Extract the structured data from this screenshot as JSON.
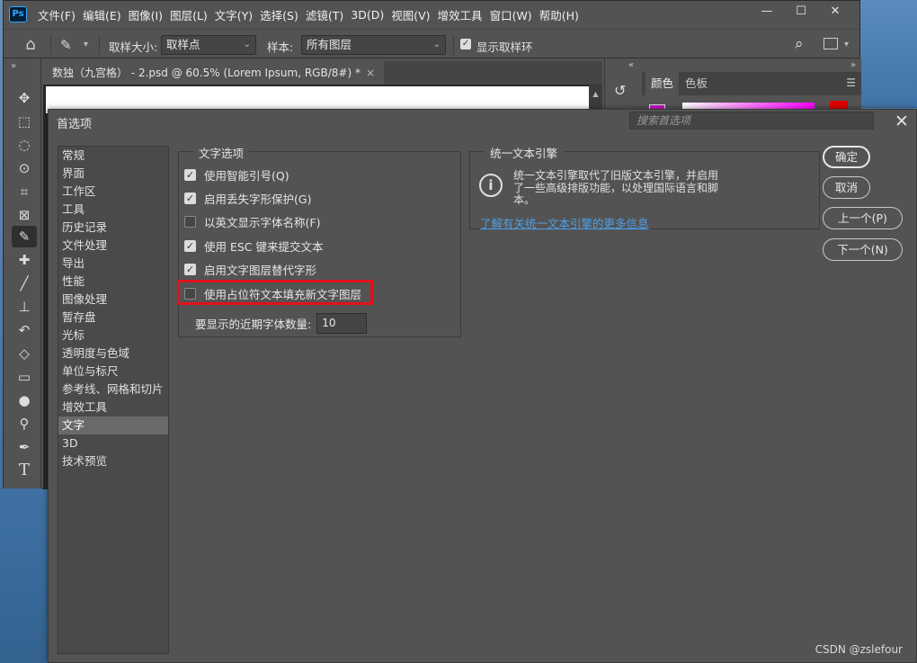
{
  "app": {
    "logo_text": "Ps",
    "menu": [
      "文件(F)",
      "编辑(E)",
      "图像(I)",
      "图层(L)",
      "文字(Y)",
      "选择(S)",
      "滤镜(T)",
      "3D(D)",
      "视图(V)",
      "增效工具",
      "窗口(W)",
      "帮助(H)"
    ],
    "window_controls": [
      "—",
      "☐",
      "✕"
    ]
  },
  "options_bar": {
    "sample_size_label": "取样大小:",
    "sample_size_value": "取样点",
    "sample_label": "样本:",
    "sample_value": "所有图层",
    "show_ring_label": "显示取样环",
    "show_ring_checked": true
  },
  "document": {
    "tab_title": "数独（九宫格） - 2.psd @ 60.5% (Lorem Ipsum, RGB/8#) *",
    "tab_close": "×"
  },
  "panels": {
    "tabs": [
      "颜色",
      "色板"
    ],
    "active_tab": "颜色"
  },
  "dialog": {
    "title": "首选项",
    "search_placeholder": "搜索首选项",
    "close": "✕",
    "categories": [
      "常规",
      "界面",
      "工作区",
      "工具",
      "历史记录",
      "文件处理",
      "导出",
      "性能",
      "图像处理",
      "暂存盘",
      "光标",
      "透明度与色域",
      "单位与标尺",
      "参考线、网格和切片",
      "增效工具",
      "文字",
      "3D",
      "技术预览"
    ],
    "selected_category": "文字",
    "text_options": {
      "title": "文字选项",
      "options": [
        {
          "label": "使用智能引号(Q)",
          "checked": true
        },
        {
          "label": "启用丢失字形保护(G)",
          "checked": true
        },
        {
          "label": "以英文显示字体名称(F)",
          "checked": false
        },
        {
          "label": "使用 ESC 键来提交文本",
          "checked": true
        },
        {
          "label": "启用文字图层替代字形",
          "checked": true
        },
        {
          "label": "使用占位符文本填充新文字图层",
          "checked": false
        }
      ],
      "recent_fonts_label": "要显示的近期字体数量:",
      "recent_fonts_value": "10"
    },
    "unified_engine": {
      "title": "统一文本引擎",
      "icon": "info-icon",
      "description": "统一文本引擎取代了旧版文本引擎，并启用了一些高级排版功能，以处理国际语言和脚本。",
      "link": "了解有关统一文本引擎的更多信息"
    },
    "buttons": {
      "ok": "确定",
      "cancel": "取消",
      "prev": "上一个(P)",
      "next": "下一个(N)"
    }
  },
  "watermark": "CSDN @zslefour",
  "colors": {
    "ui_bg": "#535353",
    "highlight": "#e0111a",
    "link": "#4d9fe8"
  }
}
